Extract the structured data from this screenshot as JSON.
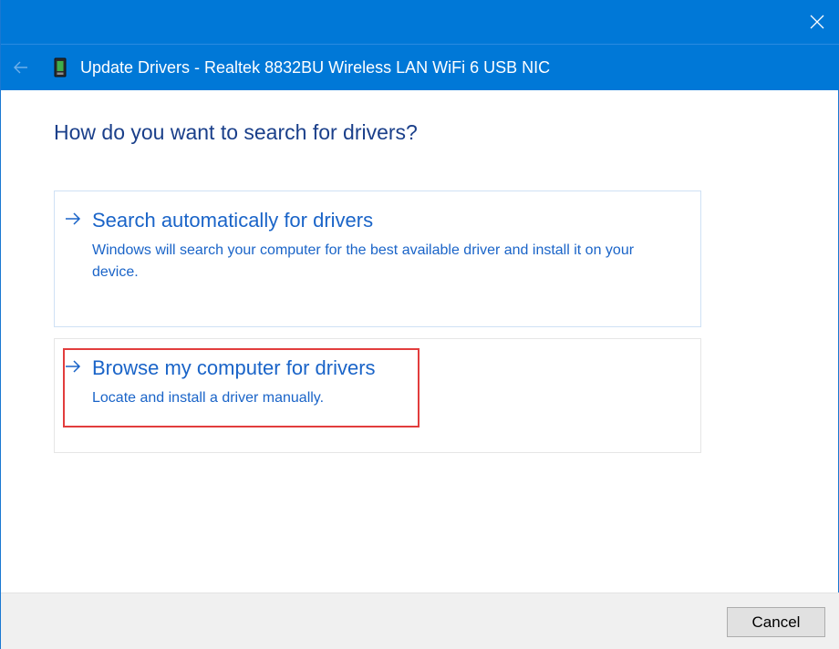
{
  "window": {
    "title": "Update Drivers - Realtek 8832BU Wireless LAN WiFi 6 USB NIC"
  },
  "icons": {
    "close": "close-icon",
    "back": "back-arrow-icon",
    "device": "network-adapter-icon",
    "option_arrow": "right-arrow-icon"
  },
  "main": {
    "question": "How do you want to search for drivers?",
    "options": [
      {
        "title": "Search automatically for drivers",
        "description": "Windows will search your computer for the best available driver and install it on your device."
      },
      {
        "title": "Browse my computer for drivers",
        "description": "Locate and install a driver manually."
      }
    ]
  },
  "footer": {
    "cancel_label": "Cancel"
  },
  "colors": {
    "header_blue": "#0078d7",
    "link_blue": "#1a64c8",
    "heading_blue": "#1a3f8a",
    "highlight_red": "#e23d3d"
  }
}
